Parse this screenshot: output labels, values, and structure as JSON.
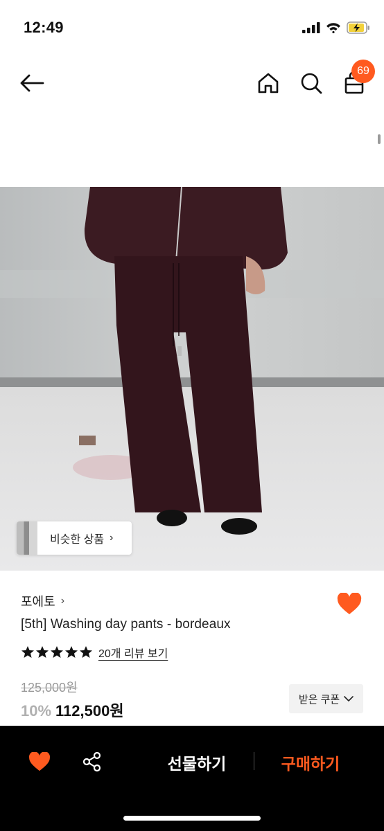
{
  "status_bar": {
    "time": "12:49"
  },
  "header": {
    "cart_count": "69"
  },
  "image": {
    "similar_products_label": "비슷한 상품",
    "similar_chevron": "›"
  },
  "product": {
    "brand": "포에토",
    "brand_chevron": "›",
    "title": "[5th] Washing day pants - bordeaux",
    "rating_stars": 5,
    "review_link": "20개 리뷰 보기",
    "original_price": "125,000원",
    "discount": "10%",
    "sale_price": "112,500원",
    "coupon_label": "받은 쿠폰",
    "wishlisted": true
  },
  "bottom_bar": {
    "gift_label": "선물하기",
    "buy_label": "구매하기"
  },
  "colors": {
    "accent": "#ff5a1f",
    "text": "#111111",
    "muted": "#9a9a9a",
    "bottom_bar": "#000000"
  },
  "icons": [
    "back-arrow-icon",
    "home-icon",
    "search-icon",
    "shopping-bag-icon",
    "heart-icon",
    "share-icon",
    "star-icon",
    "chevron-down-icon",
    "signal-icon",
    "wifi-icon",
    "battery-icon"
  ]
}
